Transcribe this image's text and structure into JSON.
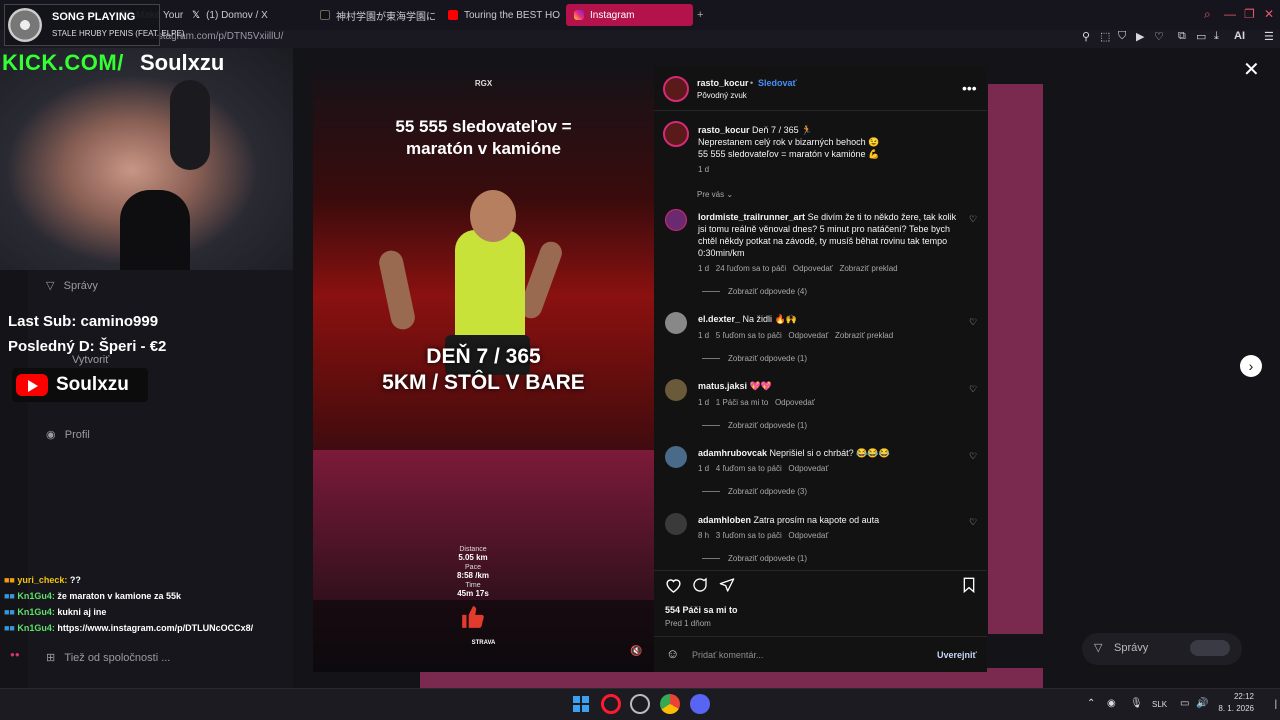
{
  "browser": {
    "tabs": [
      {
        "label": "Make Your Day",
        "icon": "page-icon",
        "active": false
      },
      {
        "label": "(1) Domov / X",
        "icon": "x-logo-icon",
        "active": false
      },
      {
        "label": "神村学園が東海学園に圧勝",
        "icon": "tiktok-icon",
        "active": false
      },
      {
        "label": "Touring the BEST HOME",
        "icon": "youtube-icon",
        "active": false
      },
      {
        "label": "Instagram",
        "icon": "instagram-icon",
        "active": true
      }
    ],
    "address": "instagram.com/p/DTN5VxiillU/",
    "ai_label": "AI"
  },
  "overlay": {
    "song_label": "SONG PLAYING",
    "song_title": "STALE HRUBY PENIS (FEAT. ELPE)",
    "kick_prefix": "KICK.COM/",
    "kick_user": "Soulxzu",
    "last_sub": "Last Sub: camino999",
    "last_donation": "Posledný D: Šperi - €2",
    "youtube_name": "Soulxzu"
  },
  "sidebar": {
    "items": [
      "Správy",
      "Vytvoriť",
      "Profil",
      "Tiež od spoločnosti ..."
    ]
  },
  "chat": [
    {
      "user": "yuri_check:",
      "msg": " ??",
      "color": "yellow"
    },
    {
      "user": "Kn1Gu4:",
      "msg": " že maraton v kamione za 55k",
      "color": "green"
    },
    {
      "user": "Kn1Gu4:",
      "msg": " kukni aj ine",
      "color": "green"
    },
    {
      "user": "Kn1Gu4:",
      "msg": " https://www.instagram.com/p/DTLUNcOCCx8/",
      "color": "green"
    }
  ],
  "reel": {
    "brand": "RGX",
    "title_line1": "55 555 sledovateľov =",
    "title_line2": "maratón v kamióne",
    "day_line1": "DEŇ 7 / 365",
    "day_line2": "5KM / STÔL V BARE",
    "stats": [
      {
        "label": "Distance",
        "value": "5.05 km"
      },
      {
        "label": "Pace",
        "value": "8:58 /km"
      },
      {
        "label": "Time",
        "value": "45m 17s"
      }
    ],
    "strava_label": "STRAVA"
  },
  "post": {
    "author": "rasto_kocur",
    "follow_label": "Sledovať",
    "audio": "Pôvodný zvuk",
    "caption_prefix": "Deň 7 / 365 🏃",
    "caption_line2": "Neprestanem celý rok v bizarných behoch 😉",
    "caption_line3": "55 555 sledovateľov = maratón v kamióne 💪",
    "caption_age": "1 d",
    "for_you": "Pre vás",
    "likes": "554 Páči sa mi to",
    "posted": "Pred 1 dňom",
    "add_comment_placeholder": "Pridať komentár...",
    "publish_label": "Uverejniť"
  },
  "comments": [
    {
      "user": "lordmiste_trailrunner_art",
      "text": "Se divím že ti to někdo žere, tak kolik jsi tomu reálně věnoval dnes? 5 minut pro natáčení? Tebe bych chtěl někdy potkat na závodě, ty musíš běhat rovinu tak tempo 0:30min/km",
      "age": "1 d",
      "likes": "24 ľuďom sa to páči",
      "reply": "Odpovedať",
      "translate": "Zobraziť preklad",
      "view_replies": "Zobraziť odpovede (4)"
    },
    {
      "user": "el.dexter_",
      "text": "Na židli 🔥🙌",
      "age": "1 d",
      "likes": "5 ľuďom sa to páči",
      "reply": "Odpovedať",
      "translate": "Zobraziť preklad",
      "view_replies": "Zobraziť odpovede (1)"
    },
    {
      "user": "matus.jaksi",
      "text": "💖💖",
      "age": "1 d",
      "likes": "1 Páči sa mi to",
      "reply": "Odpovedať",
      "translate": "",
      "view_replies": "Zobraziť odpovede (1)"
    },
    {
      "user": "adamhrubovcak",
      "text": "Neprišiel si o chrbát? 😂😂😂",
      "age": "1 d",
      "likes": "4 ľuďom sa to páči",
      "reply": "Odpovedať",
      "translate": "",
      "view_replies": "Zobraziť odpovede (3)"
    },
    {
      "user": "adamhloben",
      "text": "Zatra prosím na kapote od auta",
      "age": "8 h",
      "likes": "3 ľuďom sa to páči",
      "reply": "Odpovedať",
      "translate": "",
      "view_replies": "Zobraziť odpovede (1)"
    }
  ],
  "messages_button": "Správy",
  "taskbar": {
    "lang": "SLK",
    "time": "22:12",
    "date": "8. 1. 2026"
  },
  "colors": {
    "accent_tab": "#b3124a",
    "kick_green": "#33ff33",
    "ig_blue": "#4a8df8"
  }
}
